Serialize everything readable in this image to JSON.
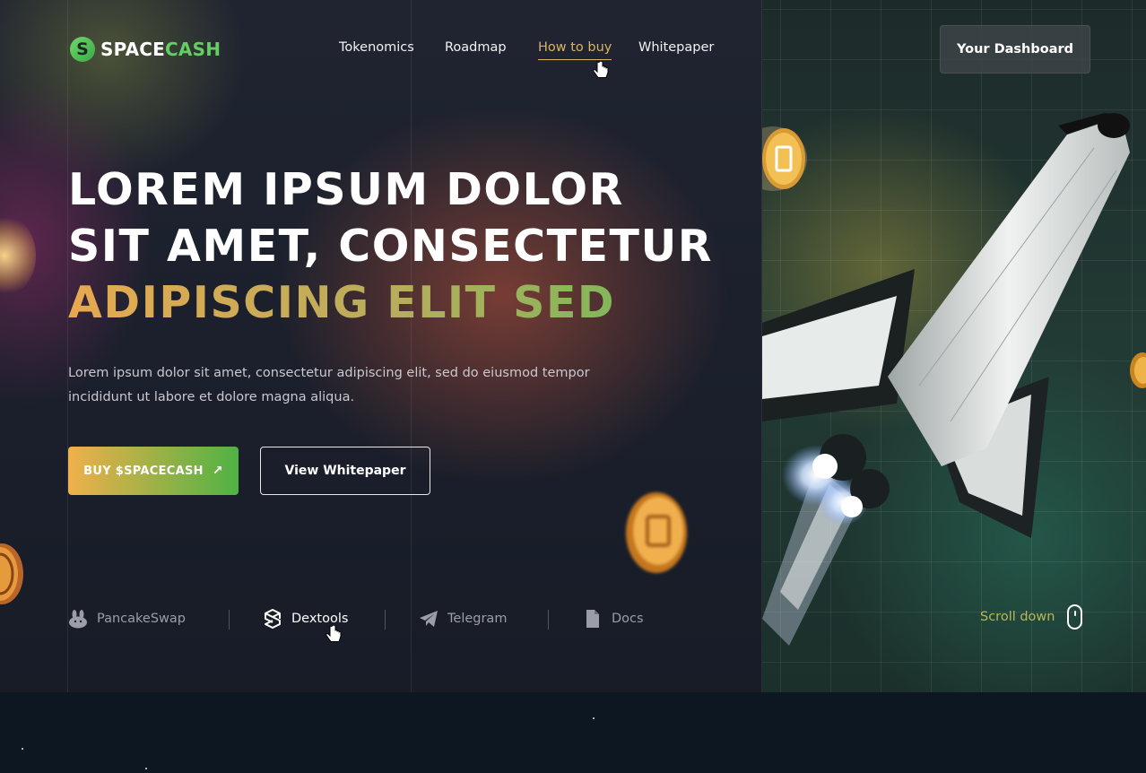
{
  "brand": {
    "name_part1": "SPACE",
    "name_part2": "CASH",
    "logo_icon": "s-coin-icon",
    "colors": {
      "green": "#63cf62",
      "gold": "#d9b45c"
    }
  },
  "nav": {
    "items": [
      {
        "label": "Tokenomics",
        "active": false
      },
      {
        "label": "Roadmap",
        "active": false
      },
      {
        "label": "How to buy",
        "active": true
      },
      {
        "label": "Whitepaper",
        "active": false
      }
    ],
    "dashboard_label": "Your Dashboard"
  },
  "hero": {
    "line1": "LOREM IPSUM DOLOR",
    "line2": "SIT AMET, CONSECTETUR",
    "line3": "ADIPISCING ELIT SED",
    "subtext": "Lorem ipsum dolor sit amet, consectetur adipiscing elit, sed do eiusmod tempor incididunt ut labore et dolore magna aliqua.",
    "buy_label": "BUY $SPACECASH",
    "buy_icon": "arrow-up-right-icon",
    "whitepaper_label": "View Whitepaper"
  },
  "partners": [
    {
      "label": "PancakeSwap",
      "icon": "bunny-icon"
    },
    {
      "label": "Dextools",
      "icon": "dextools-icon"
    },
    {
      "label": "Telegram",
      "icon": "telegram-icon"
    },
    {
      "label": "Docs",
      "icon": "document-icon"
    }
  ],
  "scroll": {
    "label": "Scroll down",
    "icon": "mouse-icon"
  },
  "colors": {
    "buy_gradient_start": "#f0b04a",
    "buy_gradient_end": "#4fb244",
    "scroll_text": "#b9b85a"
  }
}
